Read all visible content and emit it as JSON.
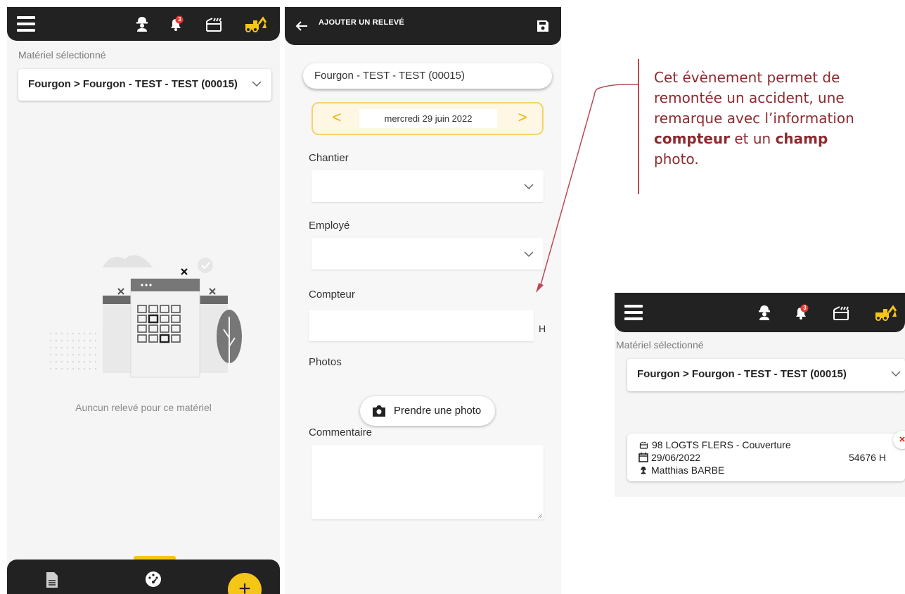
{
  "panel_list": {
    "notification_count": "3",
    "selected_label": "Matériel sélectionné",
    "selected_value": "Fourgon > Fourgon - TEST - TEST (00015)",
    "empty_message": "Auncun relevé pour ce matériel",
    "fab_label": "+"
  },
  "panel_form": {
    "title": "AJOUTER UN RELEVÉ",
    "equipment": "Fourgon - TEST - TEST (00015)",
    "date": "mercredi 29 juin 2022",
    "prev": "<",
    "next": ">",
    "fields": {
      "chantier": "Chantier",
      "employe": "Employé",
      "compteur": "Compteur",
      "unit": "H",
      "photos": "Photos",
      "photo_button": "Prendre une photo",
      "commentaire": "Commentaire"
    }
  },
  "annotation": {
    "line1": "Cet évènement permet de",
    "line2": "remontée un accident, une",
    "line3": "remarque avec l’information",
    "bold1": "compteur",
    "and": " et un ",
    "bold2": "champ",
    "line5": "photo."
  },
  "panel_result": {
    "notification_count": "3",
    "selected_label": "Matériel sélectionné",
    "selected_value": "Fourgon > Fourgon - TEST - TEST (00015)",
    "delete_label": "×",
    "entry": {
      "site": "98 LOGTS FLERS - Couverture",
      "date": "29/06/2022",
      "counter": "54676 H",
      "employee": "Matthias BARBE"
    }
  },
  "colors": {
    "topbar": "#222222",
    "accent": "#f5c518",
    "annotation": "#8e2a2f",
    "badge": "#e53935"
  },
  "icons": [
    "menu-icon",
    "worker-icon",
    "bell-icon",
    "construction-site-icon",
    "excavator-icon",
    "back-arrow-icon",
    "save-icon",
    "chevron-down-icon",
    "camera-icon",
    "document-icon",
    "gauge-icon",
    "calendar-icon",
    "close-icon"
  ]
}
